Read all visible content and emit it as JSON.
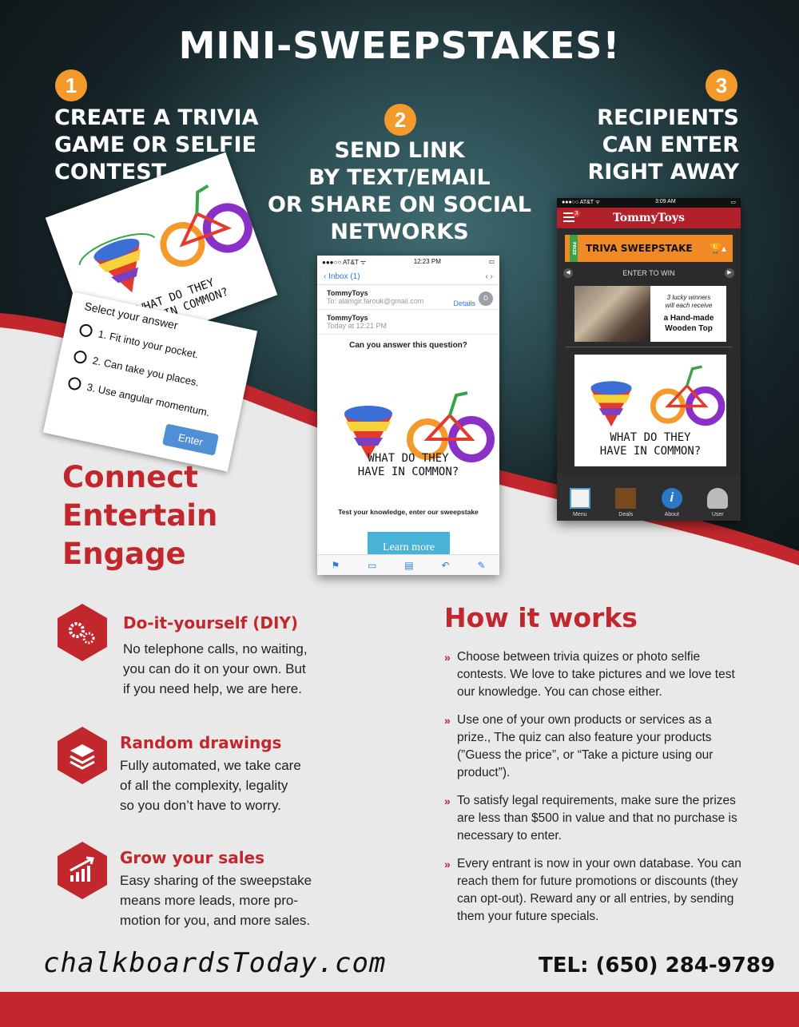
{
  "header": {
    "title": "MINI-SWEEPSTAKES!"
  },
  "steps": [
    {
      "num": "1",
      "text": "CREATE A TRIVIA\nGAME OR SELFIE\nCONTEST"
    },
    {
      "num": "2",
      "text": "SEND LINK\nBY TEXT/EMAIL\nOR SHARE ON SOCIAL\nNETWORKS"
    },
    {
      "num": "3",
      "text": "RECIPIENTS\nCAN ENTER\nRIGHT AWAY"
    }
  ],
  "quiz_card": {
    "doodle_text_line1": "WHAT DO THEY",
    "doodle_text_line2": "HAVE IN COMMON?",
    "select_label": "Select your answer",
    "options": [
      "1.   Fit into your pocket.",
      "2.   Can take you places.",
      "3.   Use angular momentum."
    ],
    "enter_label": "Enter"
  },
  "email_phone": {
    "carrier": "●●●○○ AT&T ᯤ",
    "time": "12:23 PM",
    "inbox_label": "‹ Inbox (1)",
    "nav_arrows": "‹   ›",
    "sender1": "TommyToys",
    "to_label": "To:",
    "to_address": "alamgir.farouk@gmail.com",
    "details": "Details",
    "avatar_letter": "D",
    "sender2": "TommyToys",
    "sent_time": "Today at 12:21 PM",
    "question": "Can you answer this question?",
    "doodle_text_line1": "WHAT DO THEY",
    "doodle_text_line2": "HAVE IN COMMON?",
    "test_text": "Test your knowledge, enter our sweepstake",
    "learn_more": "Learn more"
  },
  "app_phone": {
    "carrier": "●●●○○ AT&T ᯤ",
    "time": "3:09 AM",
    "badge": "3",
    "brand": "TommyToys",
    "ribbon": "PRIZE",
    "prize_title": "TRIVA SWEEPSTAKE",
    "enter_to_win": "ENTER TO WIN",
    "banner_italic": "3 lucky winners\nwill each receive",
    "banner_bold": "a Hand-made\nWooden Top",
    "doodle_text_line1": "WHAT DO THEY",
    "doodle_text_line2": "HAVE IN COMMON?",
    "tabs": [
      "Menu",
      "Deals",
      "About",
      "User"
    ]
  },
  "tagline": "Connect\nEntertain\nEngage",
  "features": [
    {
      "title": "Do-it-yourself (DIY)",
      "body": "No telephone calls, no waiting,\nyou can do it on your own. But\nif you need help, we are here."
    },
    {
      "title": "Random drawings",
      "body": "Fully automated, we take care\nof all the complexity, legality\nso you don’t have to worry."
    },
    {
      "title": "Grow your sales",
      "body": "Easy sharing of the sweepstake\nmeans more leads, more pro-\nmotion for you, and more sales."
    }
  ],
  "how_it_works": {
    "title": "How it works",
    "items": [
      "Choose between trivia quizes or photo selfie contests. We love to take pictures and we love test our knowledge. You can chose either.",
      "Use one of your own products or services as a prize., The quiz can also feature your products (”Guess the price”, or “Take a picture using our product”).",
      "To satisfy legal requirements, make sure the prizes are less than $500 in value and that no purchase is necessary to enter.",
      "Every entrant is now in your own database. You can reach them for future promotions or discounts (they can opt-out). Reward any or all entries, by sending them your future specials."
    ]
  },
  "footer": {
    "site": "chalkboardsToday.com",
    "tel": "TEL: (650) 284-9789"
  },
  "colors": {
    "accent_red": "#c1272d",
    "orange": "#f39a2b",
    "hero_dark": "#152226"
  }
}
